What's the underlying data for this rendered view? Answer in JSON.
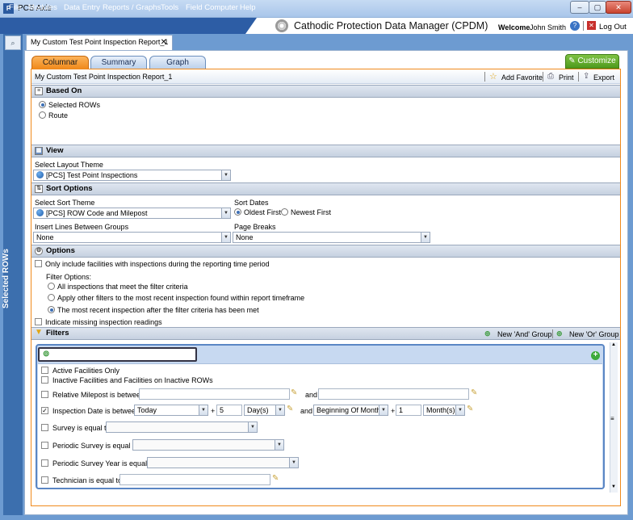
{
  "window": {
    "title": "PCS Axis",
    "app_icon": "pcs-icon"
  },
  "menu": [
    "File",
    "Modules",
    "Data Entry",
    "Reports / Graphs",
    "Tools",
    "Field Computer",
    "Help"
  ],
  "app_title": "Cathodic Protection Data Manager (CPDM)",
  "user": {
    "welcome": "Welcome",
    "name": "John Smith",
    "logout": "Log Out"
  },
  "left_strip": {
    "label": "Selected ROWs"
  },
  "doc_tab": {
    "label": "My Custom Test Point Inspection Report_1"
  },
  "view_tabs": [
    "Columnar",
    "Summary",
    "Graph"
  ],
  "customize": "Customize",
  "report": {
    "name": "My Custom Test Point Inspection Report_1",
    "add_favorite": "Add Favorite",
    "print": "Print",
    "export": "Export"
  },
  "based_on": {
    "header": "Based On",
    "options": [
      "Selected ROWs",
      "Route"
    ]
  },
  "view": {
    "header": "View",
    "layout_label": "Select Layout Theme",
    "layout_value": "[PCS] Test Point Inspections"
  },
  "sort": {
    "header": "Sort Options",
    "theme_label": "Select Sort Theme",
    "theme_value": "[PCS] ROW Code and Milepost",
    "dates_label": "Sort Dates",
    "oldest": "Oldest First",
    "newest": "Newest First",
    "insert_label": "Insert Lines Between Groups",
    "insert_value": "None",
    "breaks_label": "Page Breaks",
    "breaks_value": "None"
  },
  "options": {
    "header": "Options",
    "only_include": "Only include facilities with inspections during the reporting time period",
    "filter_options_label": "Filter Options:",
    "filter_opts": [
      "All inspections that meet the filter criteria",
      "Apply other filters to the most recent inspection found within report timeframe",
      "The most recent inspection after the filter criteria has been met"
    ],
    "missing": "Indicate missing inspection readings"
  },
  "filters": {
    "header": "Filters",
    "new_and": "New 'And' Group",
    "new_or": "New 'Or' Group",
    "active": "Active Facilities Only",
    "inactive": "Inactive Facilities and Facilities on Inactive ROWs",
    "milepost": "Relative Milepost is between",
    "and": "and",
    "insp_date": "Inspection Date is between",
    "today": "Today",
    "plus": "+",
    "n1": "5",
    "unit1": "Day(s)",
    "bom": "Beginning Of Month",
    "n2": "1",
    "unit2": "Month(s)",
    "survey": "Survey is equal to",
    "periodic": "Periodic Survey is equal to",
    "periodic_year": "Periodic Survey Year is equal to",
    "technician": "Technician is equal to"
  }
}
